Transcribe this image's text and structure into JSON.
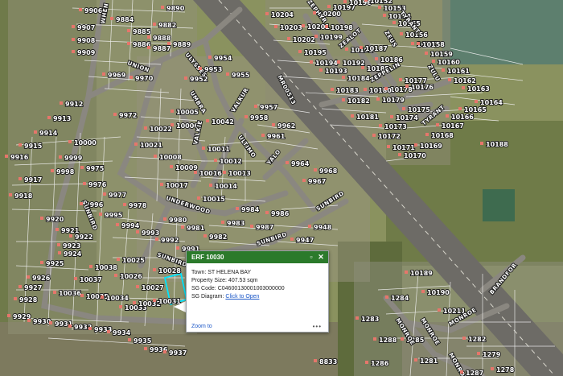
{
  "map": {
    "colors": {
      "terrain": "#7f8a5c",
      "vegetation_dark": "#4f5a35",
      "parcel_line": "#f5f5f5",
      "road_surface": "#8a8780",
      "highway": "#6d6b66",
      "selected_parcel": "#00e5ff",
      "label_marker": "#e6766b"
    },
    "erf_labels": [
      "9906",
      "9907",
      "9908",
      "9909",
      "9884",
      "9885",
      "9886",
      "9887",
      "9890",
      "9882",
      "9888",
      "9889",
      "9954",
      "9952",
      "9953",
      "9955",
      "9969",
      "9970",
      "9912",
      "9913",
      "9914",
      "9915",
      "9916",
      "10000",
      "9999",
      "9998",
      "9917",
      "9918",
      "9976",
      "9975",
      "9977",
      "9972",
      "10022",
      "10021",
      "10008",
      "10005",
      "10006",
      "10042",
      "10011",
      "10012",
      "10013",
      "9958",
      "9957",
      "9961",
      "9962",
      "9964",
      "9968",
      "9967",
      "10009",
      "10017",
      "10016",
      "10015",
      "10014",
      "9980",
      "9981",
      "9983",
      "9984",
      "9986",
      "9987",
      "9982",
      "9947",
      "9948",
      "9978",
      "9995",
      "9996",
      "9994",
      "9993",
      "9992",
      "9991",
      "9920",
      "9921",
      "9922",
      "9923",
      "9924",
      "9925",
      "9926",
      "9927",
      "9928",
      "9929",
      "9930",
      "9931",
      "9932",
      "9933",
      "9934",
      "9935",
      "9936",
      "9937",
      "10025",
      "10026",
      "10027",
      "10028",
      "10036",
      "10037",
      "10038",
      "10035",
      "10034",
      "10033",
      "10032",
      "10031",
      "8833",
      "10204",
      "10203",
      "10202",
      "10201",
      "10200",
      "10195",
      "10194",
      "10192",
      "10191",
      "10193",
      "10199",
      "10198",
      "10197",
      "10196",
      "10155",
      "10154",
      "10153",
      "10152",
      "10156",
      "10157",
      "10158",
      "10159",
      "10160",
      "10161",
      "10162",
      "10163",
      "10164",
      "10165",
      "10166",
      "10167",
      "10168",
      "10169",
      "10170",
      "10171",
      "10172",
      "10173",
      "10174",
      "10175",
      "10176",
      "10177",
      "10178",
      "10179",
      "10180",
      "10181",
      "10182",
      "10183",
      "10184",
      "10185",
      "10186",
      "10187",
      "10188",
      "10189",
      "10190",
      "10211",
      "1283",
      "1284",
      "1285",
      "1281",
      "1282",
      "1279",
      "1278",
      "1286",
      "1287",
      "1288",
      "1095",
      "1096",
      "1280"
    ],
    "road_labels": [
      "WHEN",
      "UNION",
      "ULYSSES",
      "VALKIE",
      "UMBRA",
      "VALKUR",
      "YALO",
      "ULTIMO",
      "UNDERWOOD",
      "SUNBIRD",
      "SUNBIRD",
      "SUNBIRD",
      "SUNBIRD",
      "MR00513",
      "ZEPHYR",
      "ZEALOT",
      "ZEUS",
      "ZEPPELIN",
      "ZULU",
      "TYRANT",
      "TYRANT",
      "MONROE",
      "MONROE",
      "MONROE",
      "MONROE",
      "BRANDFOR"
    ]
  },
  "popup": {
    "title": "ERF 10030",
    "town_label": "Town:",
    "town_value": "ST HELENA BAY",
    "size_label": "Property Size:",
    "size_value": "407.53 sqm",
    "sg_code_label": "SG Code:",
    "sg_code_value": "C04600130001003000000",
    "sg_diagram_label": "SG Diagram:",
    "sg_diagram_link": "Click to Open",
    "zoom_link": "Zoom to",
    "more_icon": "ellipsis-icon",
    "maximize_icon": "maximize-icon",
    "close_icon": "close-icon"
  }
}
